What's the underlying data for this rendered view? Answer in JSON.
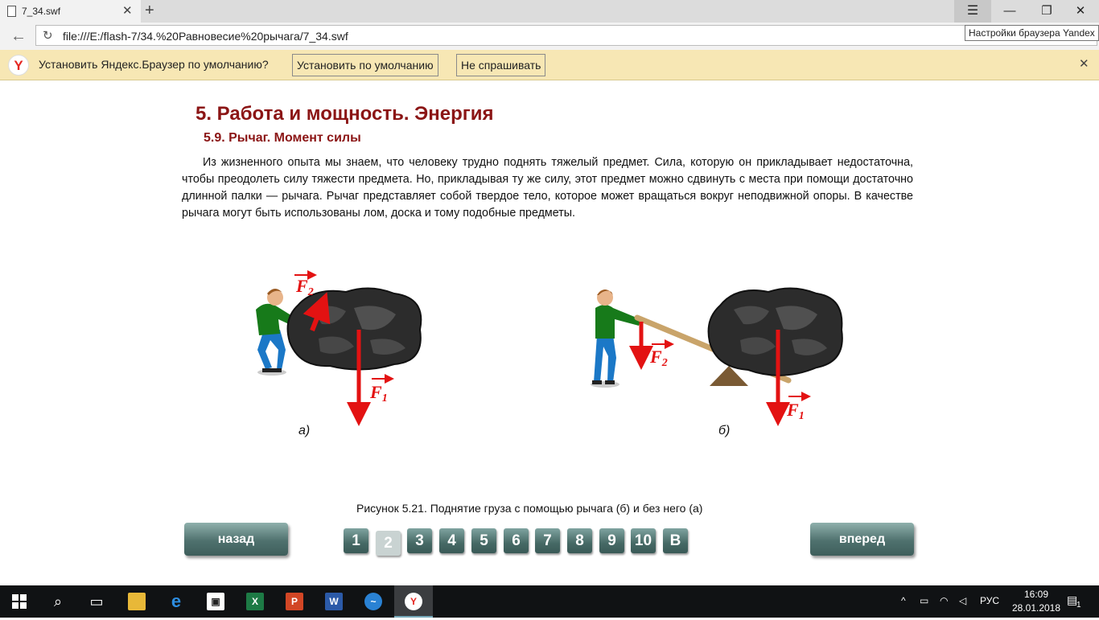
{
  "browser": {
    "tab_title": "7_34.swf",
    "url": "file:///E:/flash-7/34.%20Равновесие%20рычага/7_34.swf",
    "tooltip": "Настройки браузера Yandex",
    "infobar": {
      "logo": "Y",
      "message": "Установить Яндекс.Браузер по умолчанию?",
      "set_default_label": "Установить по умолчанию",
      "dont_ask_label": "Не спрашивать"
    },
    "icons": [
      "document-icon",
      "close-icon",
      "plus-icon",
      "menu-icon",
      "minimize-icon",
      "restore-icon",
      "back-arrow-icon",
      "reload-icon"
    ]
  },
  "page": {
    "heading": "5. Работа и мощность. Энергия",
    "subheading": "5.9. Рычаг. Момент силы",
    "paragraph": "Из жизненного опыта мы знаем, что человеку трудно поднять тяжелый предмет. Сила, которую он прикладывает недостаточна, чтобы преодолеть силу тяжести предмета. Но, прикладывая ту же силу, этот предмет можно сдвинуть с места при помощи достаточно длинной палки — рычага. Рычаг представляет собой твердое тело, которое может вращаться вокруг неподвижной опоры. В качестве рычага могут быть использованы лом, доска и тому подобные предметы.",
    "figure": {
      "label_a": "а)",
      "label_b": "б)",
      "force_letter": "F",
      "sub_1": "1",
      "sub_2": "2",
      "force_color": "#ee1111"
    },
    "caption": "Рисунок 5.21. Поднятие груза с помощью рычага (б) и без него (а)",
    "nav": {
      "back_label": "назад",
      "forward_label": "вперед",
      "pages": [
        "1",
        "2",
        "3",
        "4",
        "5",
        "6",
        "7",
        "8",
        "9",
        "10",
        "В"
      ],
      "current_page": "2"
    }
  },
  "taskbar": {
    "language": "РУС",
    "time": "16:09",
    "date": "28.01.2018",
    "notifications": "1",
    "apps": [
      "start-icon",
      "search-icon",
      "task-view-icon",
      "file-explorer-icon",
      "edge-icon",
      "store-icon",
      "excel-icon",
      "powerpoint-icon",
      "word-icon",
      "thunderbird-icon",
      "yandex-browser-icon"
    ]
  }
}
